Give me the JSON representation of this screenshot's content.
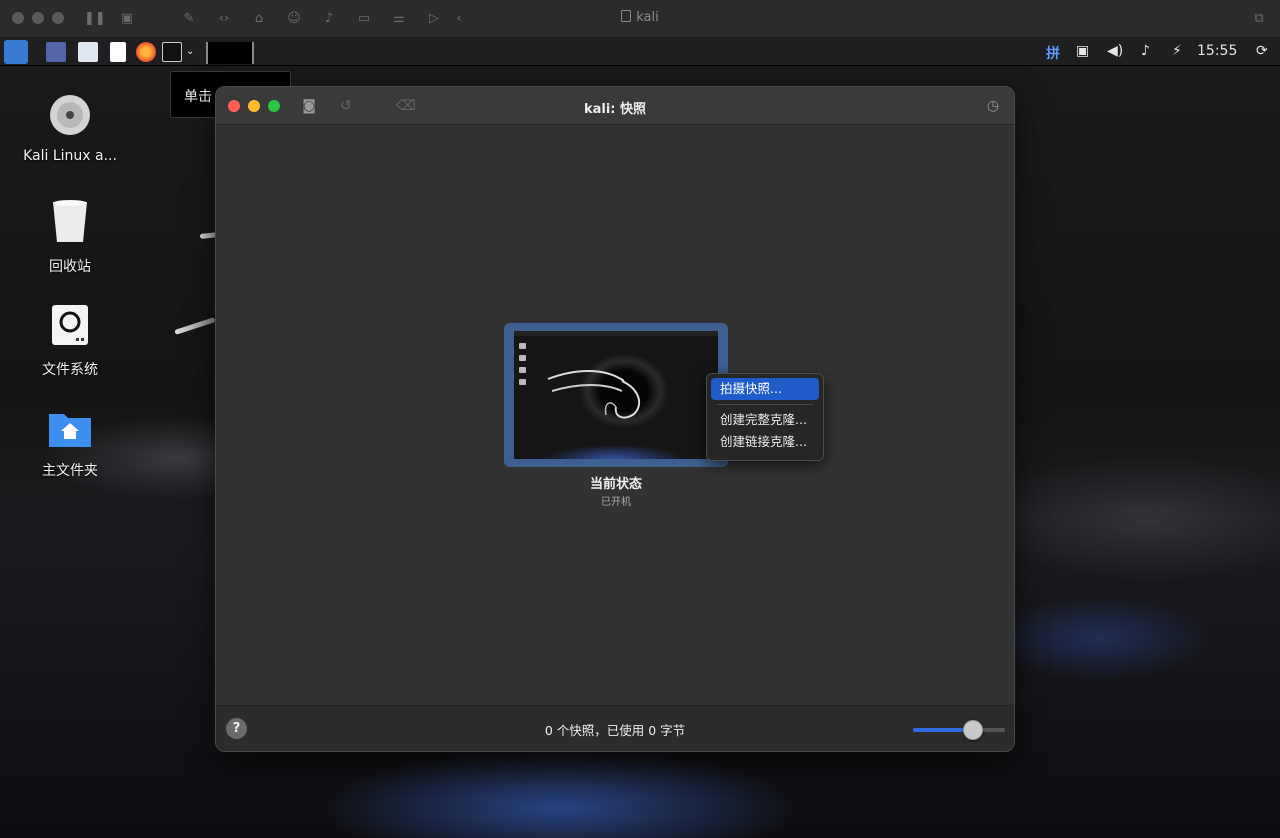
{
  "host": {
    "title": "kali"
  },
  "taskbar": {
    "time": "15:55",
    "input_method": "拼"
  },
  "tooltip": {
    "text": "单击"
  },
  "desktop_icons": [
    {
      "label": "Kali Linux a...",
      "icon": "disc-icon"
    },
    {
      "label": "回收站",
      "icon": "trash-icon"
    },
    {
      "label": "文件系统",
      "icon": "drive-icon"
    },
    {
      "label": "主文件夹",
      "icon": "home-folder-icon"
    }
  ],
  "dialog": {
    "title": "kali: 快照",
    "snapshot": {
      "name": "当前状态",
      "state": "已开机"
    },
    "context_menu": {
      "items": [
        "拍摄快照...",
        "创建完整克隆...",
        "创建链接克隆..."
      ],
      "selected_index": 0
    },
    "footer": {
      "help": "?",
      "status": "0 个快照，已使用 0 字节",
      "zoom_level": 0.65
    }
  },
  "colors": {
    "accent": "#1f5cc9",
    "close": "#ff5f57",
    "minimize": "#febc2e",
    "zoom": "#28c840"
  }
}
